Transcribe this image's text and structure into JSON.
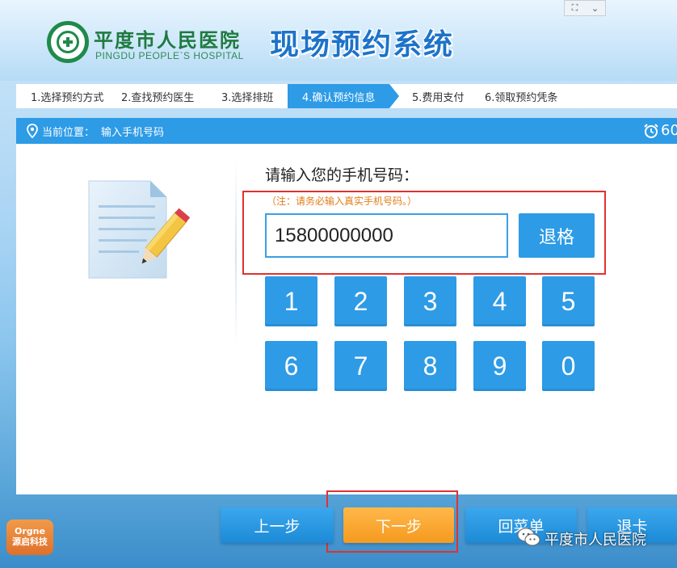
{
  "header": {
    "hospital_name_cn": "平度市人民医院",
    "hospital_name_en": "PINGDU PEOPLE`S HOSPITAL",
    "system_title": "现场预约系统"
  },
  "steps": [
    {
      "label": "1.选择预约方式",
      "active": false
    },
    {
      "label": "2.查找预约医生",
      "active": false
    },
    {
      "label": "3.选择排班",
      "active": false
    },
    {
      "label": "4.确认预约信息",
      "active": true
    },
    {
      "label": "5.费用支付",
      "active": false
    },
    {
      "label": "6.领取预约凭条",
      "active": false
    }
  ],
  "location": {
    "label": "当前位置：",
    "value": "输入手机号码",
    "timer": "60"
  },
  "form": {
    "prompt": "请输入您的手机号码：",
    "note": "（注：请务必输入真实手机号码。）",
    "phone_value": "15800000000",
    "backspace_label": "退格"
  },
  "keypad": [
    "1",
    "2",
    "3",
    "4",
    "5",
    "6",
    "7",
    "8",
    "9",
    "0"
  ],
  "nav": {
    "prev": "上一步",
    "next": "下一步",
    "menu": "回菜单",
    "exit_card": "退卡"
  },
  "brand": {
    "line1": "Orgne",
    "line2": "源启科技"
  },
  "watermark": "平度市人民医院",
  "colors": {
    "primary_blue": "#2d9be6",
    "accent_orange": "#f59a1f",
    "note_orange": "#e37d18",
    "highlight_red": "#e0322f",
    "logo_green": "#1f8a4a"
  }
}
